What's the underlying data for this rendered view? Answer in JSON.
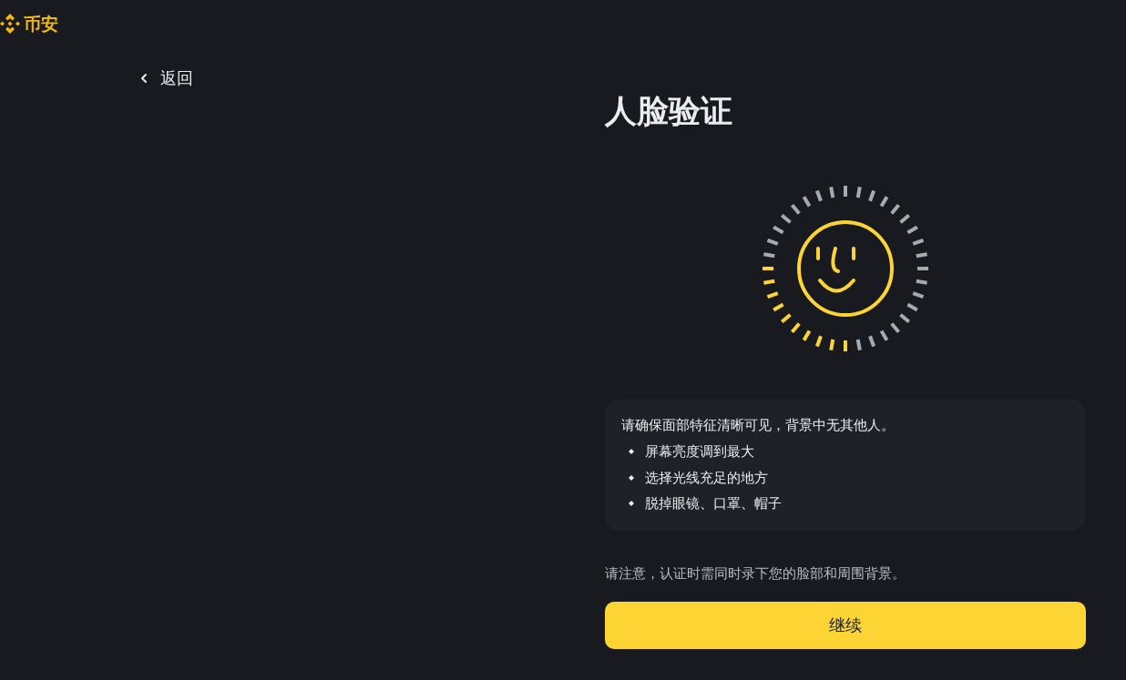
{
  "header": {
    "logo_text": "币安"
  },
  "back_link": {
    "label": "返回"
  },
  "title": "人脸验证",
  "tips": {
    "intro": "请确保面部特征清晰可见，背景中无其他人。",
    "items": [
      "屏幕亮度调到最大",
      "选择光线充足的地方",
      "脱掉眼镜、口罩、帽子"
    ]
  },
  "note": "请注意，认证时需同时录下您的脸部和周围背景。",
  "continue_button": {
    "label": "继续"
  }
}
